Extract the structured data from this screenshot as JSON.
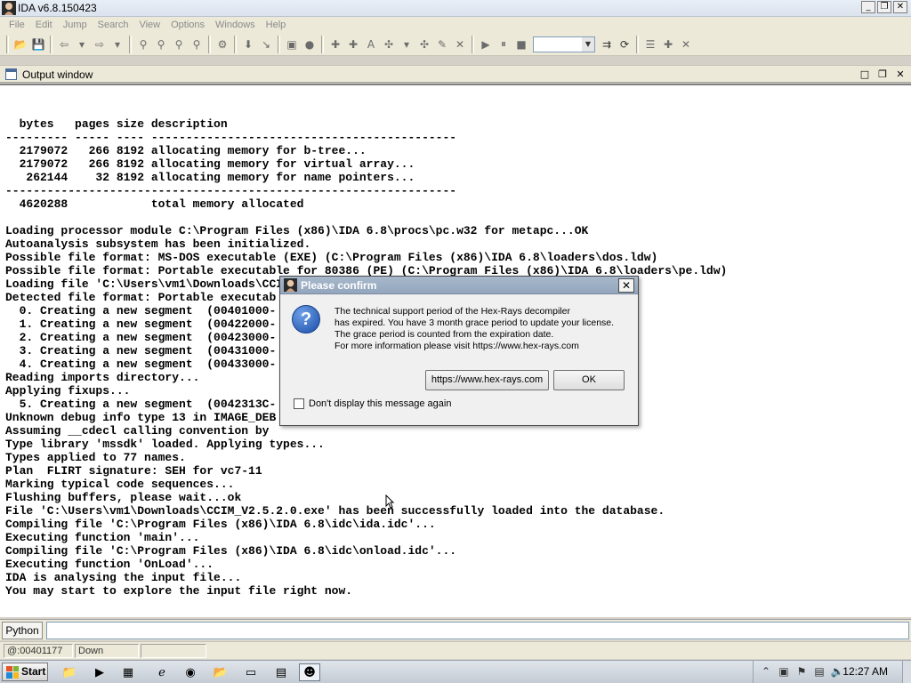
{
  "window": {
    "title": "IDA v6.8.150423",
    "min_label": "_",
    "restore_label": "❐",
    "close_label": "✕"
  },
  "menu": [
    "File",
    "Edit",
    "Jump",
    "Search",
    "View",
    "Options",
    "Windows",
    "Help"
  ],
  "output_window": {
    "title": "Output window",
    "lines": [
      "",
      "  bytes   pages size description",
      "--------- ----- ---- --------------------------------------------",
      "  2179072   266 8192 allocating memory for b-tree...",
      "  2179072   266 8192 allocating memory for virtual array...",
      "   262144    32 8192 allocating memory for name pointers...",
      "-----------------------------------------------------------------",
      "  4620288            total memory allocated",
      "",
      "Loading processor module C:\\Program Files (x86)\\IDA 6.8\\procs\\pc.w32 for metapc...OK",
      "Autoanalysis subsystem has been initialized.",
      "Possible file format: MS-DOS executable (EXE) (C:\\Program Files (x86)\\IDA 6.8\\loaders\\dos.ldw)",
      "Possible file format: Portable executable for 80386 (PE) (C:\\Program Files (x86)\\IDA 6.8\\loaders\\pe.ldw)",
      "Loading file 'C:\\Users\\vm1\\Downloads\\CCIM_V2.5.2.0.exe' into database...",
      "Detected file format: Portable executab",
      "  0. Creating a new segment  (00401000-",
      "  1. Creating a new segment  (00422000-",
      "  2. Creating a new segment  (00423000-",
      "  3. Creating a new segment  (00431000-",
      "  4. Creating a new segment  (00433000-",
      "Reading imports directory...",
      "Applying fixups...",
      "  5. Creating a new segment  (0042313C-",
      "Unknown debug info type 13 in IMAGE_DEB",
      "Assuming __cdecl calling convention by",
      "Type library 'mssdk' loaded. Applying types...",
      "Types applied to 77 names.",
      "Plan  FLIRT signature: SEH for vc7-11",
      "Marking typical code sequences...",
      "Flushing buffers, please wait...ok",
      "File 'C:\\Users\\vm1\\Downloads\\CCIM_V2.5.2.0.exe' has been successfully loaded into the database.",
      "Compiling file 'C:\\Program Files (x86)\\IDA 6.8\\idc\\ida.idc'...",
      "Executing function 'main'...",
      "Compiling file 'C:\\Program Files (x86)\\IDA 6.8\\idc\\onload.idc'...",
      "Executing function 'OnLoad'...",
      "IDA is analysing the input file...",
      "You may start to explore the input file right now."
    ]
  },
  "python": {
    "button_label": "Python",
    "input_value": ""
  },
  "status": {
    "address": "@:00401177",
    "direction": "Down",
    "extra": ""
  },
  "dialog": {
    "title": "Please confirm",
    "message": [
      "The technical support period of the Hex-Rays decompiler",
      "has expired. You have 3 month grace period to update your license.",
      "The grace period is counted from the expiration date.",
      "For more information please visit https://www.hex-rays.com"
    ],
    "url_button": "https://www.hex-rays.com",
    "ok_button": "OK",
    "checkbox_label": "Don't display this message again",
    "checkbox_checked": false
  },
  "taskbar": {
    "start_label": "Start",
    "clock": "12:27 AM"
  },
  "colors": {
    "dialog_title": "#93a6bd",
    "question_icon": "#1a4ea8"
  }
}
